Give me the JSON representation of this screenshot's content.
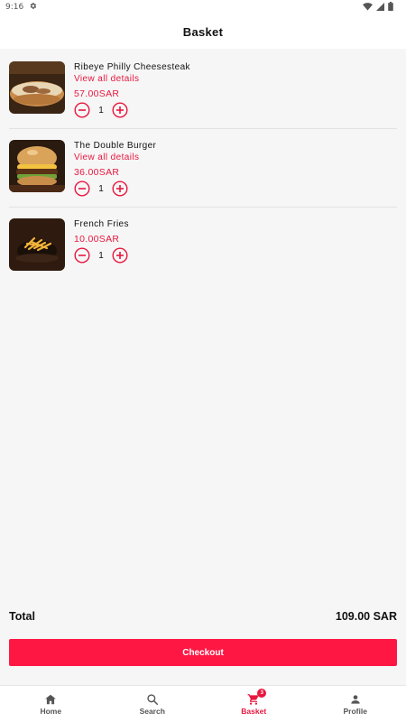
{
  "status_bar": {
    "time": "9:16"
  },
  "header": {
    "title": "Basket"
  },
  "colors": {
    "accent": "#e8173f",
    "checkout": "#ff1744",
    "background": "#f6f6f6"
  },
  "items": [
    {
      "name": "Ribeye Philly Cheesesteak",
      "details_link": "View all details",
      "price": "57.00SAR",
      "quantity": "1",
      "image": "cheesesteak-image"
    },
    {
      "name": "The Double Burger",
      "details_link": "View all details",
      "price": "36.00SAR",
      "quantity": "1",
      "image": "burger-image"
    },
    {
      "name": "French Fries",
      "details_link": "",
      "price": "10.00SAR",
      "quantity": "1",
      "image": "fries-image"
    }
  ],
  "summary": {
    "total_label": "Total",
    "total_value": "109.00 SAR"
  },
  "checkout": {
    "label": "Checkout"
  },
  "nav": {
    "items": [
      {
        "label": "Home",
        "icon": "home-icon"
      },
      {
        "label": "Search",
        "icon": "search-icon"
      },
      {
        "label": "Basket",
        "icon": "cart-icon",
        "active": true,
        "badge": "3"
      },
      {
        "label": "Profile",
        "icon": "person-icon"
      }
    ]
  }
}
